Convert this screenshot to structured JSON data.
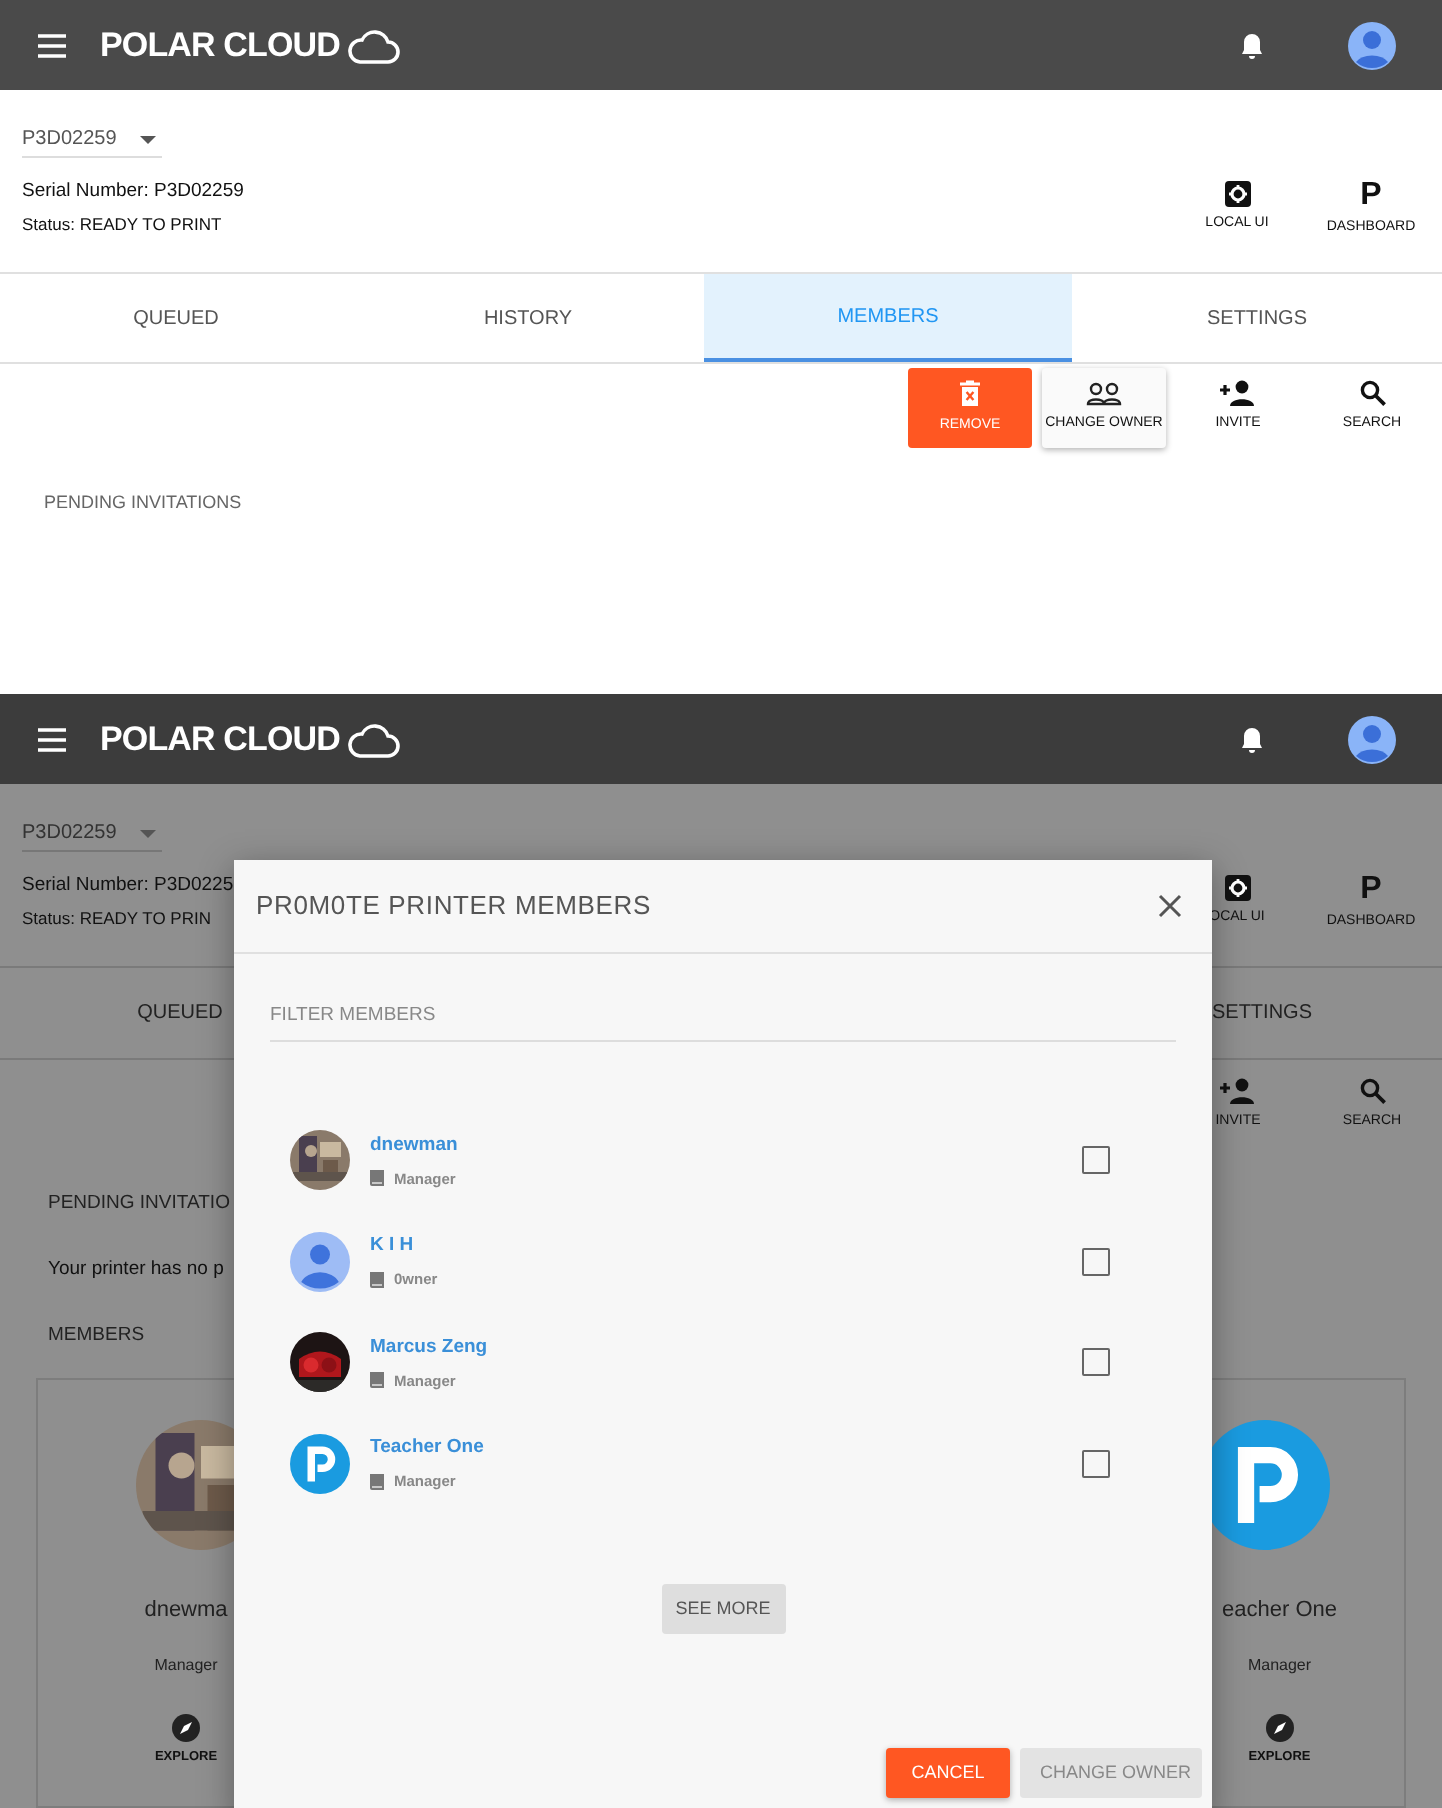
{
  "top_screen": {
    "header": {
      "brand": "POLAR CLOUD"
    },
    "printer_select": {
      "value": "P3D02259"
    },
    "serial": "Serial Number: P3D02259",
    "status": "Status: READY TO PRINT",
    "actions": [
      {
        "kind": "gear",
        "label": "LOCAL UI"
      },
      {
        "kind": "glyph",
        "glyph": "P",
        "label": "DASHBOARD"
      }
    ],
    "tabs": [
      {
        "label": "QUEUED",
        "selected": false
      },
      {
        "label": "HISTORY",
        "selected": false
      },
      {
        "label": "MEMBERS",
        "selected": true
      },
      {
        "label": "SETTINGS",
        "selected": false
      }
    ],
    "toolbar": [
      {
        "kind": "remove",
        "label": "REMOVE"
      },
      {
        "kind": "change_owner",
        "label": "CHANGE OWNER"
      },
      {
        "kind": "invite",
        "label": "INVITE"
      },
      {
        "kind": "search",
        "label": "SEARCH"
      }
    ],
    "section_label": "PENDING INVITATIONS"
  },
  "bottom_screen": {
    "header": {
      "brand": "POLAR CLOUD"
    },
    "printer_select": {
      "value": "P3D02259"
    },
    "serial": "Serial Number: P3D0225",
    "status": "Status: READY TO PRIN",
    "actions": [
      {
        "kind": "gear",
        "label": "OCAL UI"
      },
      {
        "kind": "glyph",
        "glyph": "P",
        "label": "DASHBOARD"
      }
    ],
    "tabs": [
      {
        "label": "QUEUED",
        "selected": false
      },
      {
        "label": "SETTINGS",
        "selected": false
      }
    ],
    "toolbar": [
      {
        "kind": "invite",
        "label": "INVITE"
      },
      {
        "kind": "search",
        "label": "SEARCH"
      }
    ],
    "pending_label": "PENDING INVITATIO",
    "pending_text": "Your printer has no p",
    "members_label": "MEMBERS",
    "member_cards": [
      {
        "name": "dnewma",
        "role": "Manager",
        "action": "EXPLORE"
      },
      {
        "name": "eacher One",
        "role": "Manager",
        "action": "EXPLORE",
        "kind": "logo"
      }
    ],
    "dialog": {
      "title": "PR0M0TE PRINTER MEMBERS",
      "filter": {
        "placeholder": "FILTER MEMBERS"
      },
      "members": [
        {
          "name": "dnewman",
          "role": "Manager",
          "checked": false
        },
        {
          "name": "K I H",
          "role": "0wner",
          "kind": "default",
          "checked": false
        },
        {
          "name": "Marcus Zeng",
          "role": "Manager",
          "checked": false
        },
        {
          "name": "Teacher One",
          "role": "Manager",
          "kind": "logo",
          "checked": false
        }
      ],
      "see_more": "SEE MORE",
      "buttons": [
        {
          "kind": "primary",
          "label": "CANCEL"
        },
        {
          "kind": "disabled",
          "label": "CHANGE OWNER"
        }
      ]
    }
  }
}
